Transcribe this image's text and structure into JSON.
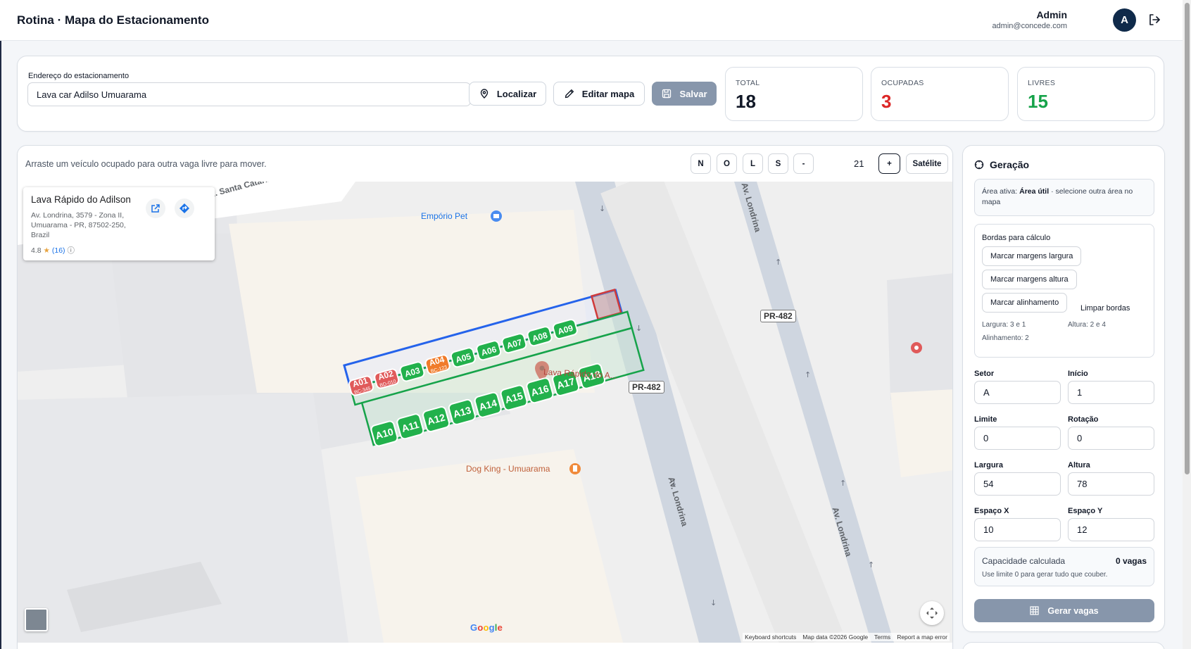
{
  "header": {
    "title": "Rotina · Mapa do Estacionamento",
    "user_name": "Admin",
    "user_email": "admin@concede.com",
    "avatar_initial": "A"
  },
  "address": {
    "label": "Endereço do estacionamento",
    "value": "Lava car Adilso Umuarama",
    "locate_label": "Localizar",
    "edit_label": "Editar mapa",
    "save_label": "Salvar"
  },
  "stats": {
    "total": {
      "label": "TOTAL",
      "value": "18",
      "color": "#111827"
    },
    "occupied": {
      "label": "OCUPADAS",
      "value": "3",
      "color": "#dc2626"
    },
    "free": {
      "label": "LIVRES",
      "value": "15",
      "color": "#16a34a"
    }
  },
  "map": {
    "hint": "Arraste um veículo ocupado para outra vaga livre para mover.",
    "controls": {
      "north": "N",
      "west": "O",
      "east": "L",
      "south": "S",
      "zoom_out": "-",
      "zoom_level": "21",
      "zoom_in": "+",
      "satellite": "Satélite"
    },
    "place": {
      "name": "Lava Rápido do Adilson",
      "address": "Av. Londrina, 3579 - Zona II, Umuarama - PR, 87502-250, Brazil",
      "rating": "4.8",
      "reviews": "(16)"
    },
    "labels": {
      "street_santa_catarina": "R. Santa Catarina",
      "street_londrina_top": "Av. Londrina",
      "street_londrina_bottom_left": "Av. Londrina",
      "street_londrina_bottom_right": "Av. Londrina",
      "route_pr482_top": "PR-482",
      "route_pr482_mid": "PR-482",
      "poi_emporio": "Empório Pet",
      "poi_dogking": "Dog King - Umuarama",
      "poi_lava_rapido": "Lava Rápido do A...",
      "google": "Google"
    },
    "footer": {
      "shortcuts": "Keyboard shortcuts",
      "map_data": "Map data ©2026 Google",
      "terms": "Terms",
      "report": "Report a map error"
    },
    "colors": {
      "free_spot": "#22b14c",
      "occupied_spot_red": "#e05a5a",
      "occupied_spot_orange": "#f07b2a",
      "area_border_blue": "#2563eb",
      "area_border_green": "#16a34a",
      "road": "#cfd6e0"
    },
    "spots_row1": [
      {
        "label": "A01",
        "plate": "BC-345",
        "state": "occupied-red"
      },
      {
        "label": "A02",
        "plate": "BD-010",
        "state": "occupied-red"
      },
      {
        "label": "A03",
        "state": "free"
      },
      {
        "label": "A04",
        "plate": "BC-123",
        "state": "occupied-orange"
      },
      {
        "label": "A05",
        "state": "free"
      },
      {
        "label": "A06",
        "state": "free"
      },
      {
        "label": "A07",
        "state": "free"
      },
      {
        "label": "A08",
        "state": "free"
      },
      {
        "label": "A09",
        "state": "free"
      }
    ],
    "spots_row2": [
      {
        "label": "A10",
        "state": "free"
      },
      {
        "label": "A11",
        "state": "free"
      },
      {
        "label": "A12",
        "state": "free"
      },
      {
        "label": "A13",
        "state": "free"
      },
      {
        "label": "A14",
        "state": "free"
      },
      {
        "label": "A15",
        "state": "free"
      },
      {
        "label": "A16",
        "state": "free"
      },
      {
        "label": "A17",
        "state": "free"
      },
      {
        "label": "A18",
        "state": "free"
      }
    ]
  },
  "generation": {
    "title": "Geração",
    "active_area_prefix": "Área ativa:",
    "active_area_name": "Área útil",
    "active_area_suffix": "· selecione outra área no mapa",
    "borders_title": "Bordas para cálculo",
    "mark_width": "Marcar margens largura",
    "mark_height": "Marcar margens altura",
    "mark_alignment": "Marcar alinhamento",
    "clear_borders": "Limpar bordas",
    "width_note": "Largura: 3 e 1",
    "height_note": "Altura: 2 e 4",
    "alignment_note": "Alinhamento: 2",
    "fields": {
      "setor": {
        "label": "Setor",
        "value": "A"
      },
      "inicio": {
        "label": "Início",
        "value": "1"
      },
      "limite": {
        "label": "Limite",
        "value": "0"
      },
      "rotacao": {
        "label": "Rotação",
        "value": "0"
      },
      "largura": {
        "label": "Largura",
        "value": "54"
      },
      "altura": {
        "label": "Altura",
        "value": "78"
      },
      "espaco_x": {
        "label": "Espaço X",
        "value": "10"
      },
      "espaco_y": {
        "label": "Espaço Y",
        "value": "12"
      }
    },
    "capacity_label": "Capacidade calculada",
    "capacity_value": "0 vagas",
    "capacity_hint": "Use limite 0 para gerar tudo que couber.",
    "generate_label": "Gerar vagas"
  }
}
